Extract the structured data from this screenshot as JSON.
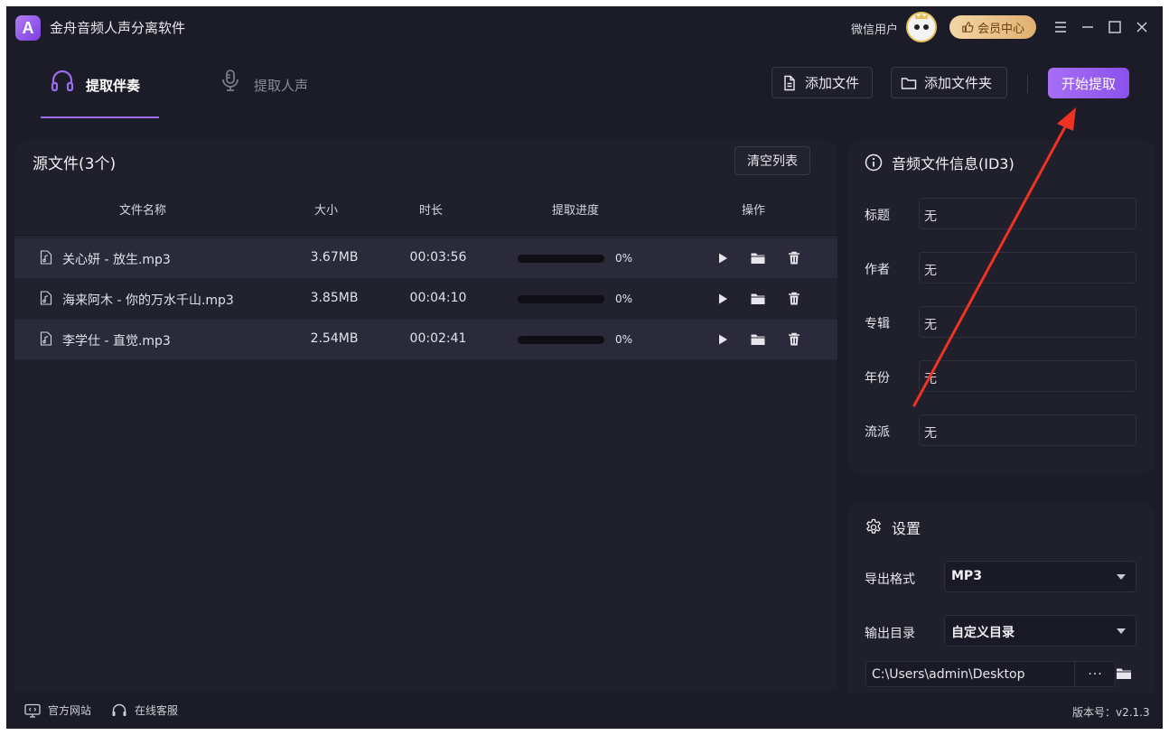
{
  "app": {
    "logo_letter": "A",
    "title": "金舟音频人声分离软件"
  },
  "user": {
    "name": "微信用户",
    "vip_label": "会员中心"
  },
  "tabs": [
    {
      "label": "提取伴奏",
      "active": true
    },
    {
      "label": "提取人声",
      "active": false
    }
  ],
  "toolbar": {
    "add_file": "添加文件",
    "add_folder": "添加文件夹",
    "start": "开始提取"
  },
  "source": {
    "title": "源文件(3个)",
    "clear_label": "清空列表",
    "columns": [
      "文件名称",
      "大小",
      "时长",
      "提取进度",
      "操作"
    ],
    "rows": [
      {
        "name": "关心妍 - 放生.mp3",
        "size": "3.67MB",
        "duration": "00:03:56",
        "progress": "0%"
      },
      {
        "name": "海来阿木 - 你的万水千山.mp3",
        "size": "3.85MB",
        "duration": "00:04:10",
        "progress": "0%"
      },
      {
        "name": "李学仕 - 直觉.mp3",
        "size": "2.54MB",
        "duration": "00:02:41",
        "progress": "0%"
      }
    ]
  },
  "info": {
    "title": "音频文件信息(ID3)",
    "fields": [
      {
        "label": "标题",
        "value": "无"
      },
      {
        "label": "作者",
        "value": "无"
      },
      {
        "label": "专辑",
        "value": "无"
      },
      {
        "label": "年份",
        "value": "无"
      },
      {
        "label": "流派",
        "value": "无"
      }
    ]
  },
  "settings": {
    "title": "设置",
    "format_label": "导出格式",
    "format_value": "MP3",
    "output_label": "输出目录",
    "output_value": "自定义目录",
    "path": "C:\\Users\\admin\\Desktop",
    "path_more": "···"
  },
  "footer": {
    "website": "官方网站",
    "support": "在线客服",
    "version": "版本号：v2.1.3"
  },
  "colors": {
    "accent": "#9b6cf0",
    "background": "#1c1c28",
    "panel": "#20202d",
    "annotation": "#ee3322"
  }
}
